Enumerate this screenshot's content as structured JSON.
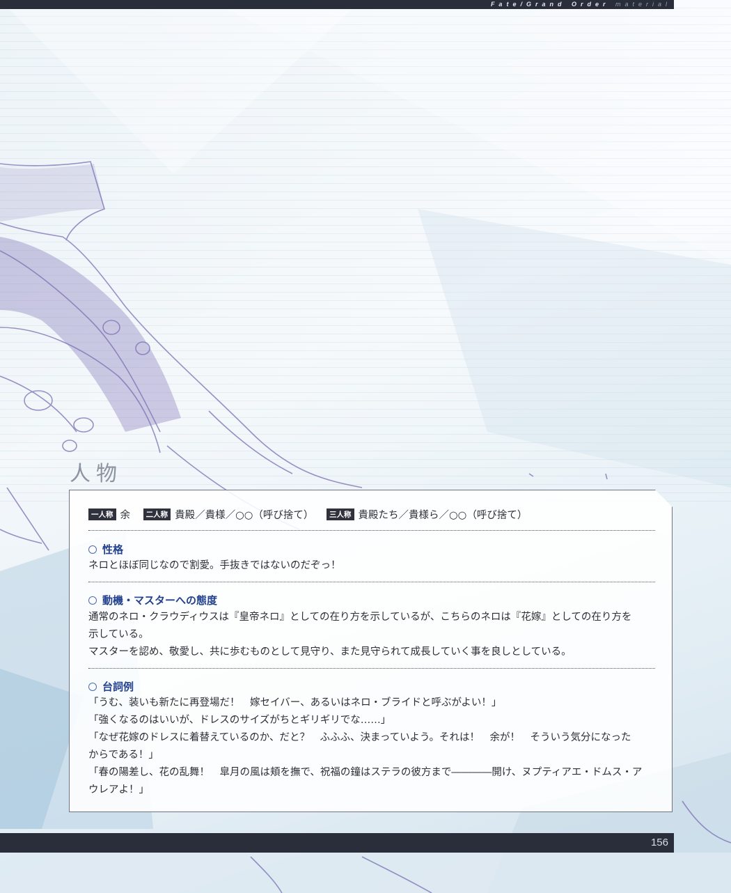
{
  "header": {
    "title_bold": "Fate/Grand Order",
    "title_light": "material"
  },
  "section": {
    "title": "人物"
  },
  "pronouns": [
    {
      "tag": "一人称",
      "value": "余"
    },
    {
      "tag": "二人称",
      "value": "貴殿／貴様／○○（呼び捨て）"
    },
    {
      "tag": "三人称",
      "value": "貴殿たち／貴様ら／○○（呼び捨て）"
    }
  ],
  "personality": {
    "heading": "性格",
    "text": "ネロとほぼ同じなので割愛。手抜きではないのだぞっ！"
  },
  "motivation": {
    "heading": "動機・マスターへの態度",
    "line1": "通常のネロ・クラウディウスは『皇帝ネロ』としての在り方を示しているが、こちらのネロは『花嫁』としての在り方を",
    "line2": "示している。",
    "line3": "マスターを認め、敬愛し、共に歩むものとして見守り、また見守られて成長していく事を良しとしている。"
  },
  "lines": {
    "heading": "台詞例",
    "l1": "「うむ、装いも新たに再登場だ！　嫁セイバー、あるいはネロ・ブライドと呼ぶがよい！」",
    "l2": "「強くなるのはいいが、ドレスのサイズがちとギリギリでな……」",
    "l3a": "「なぜ花嫁のドレスに着替えているのか、だと？　ふふふ、決まっていよう。それは！　余が！　そういう気分になった",
    "l3b": "からである！」",
    "l4a": "「春の陽差し、花の乱舞！　皐月の風は頬を撫で、祝福の鐘はステラの彼方まで――――開け、ヌプティアエ・ドムス・ア",
    "l4b": "ウレアよ！」"
  },
  "footer": {
    "page_number": "156"
  },
  "colors": {
    "bar": "#2a2d3a",
    "heading": "#23418e",
    "sketch": "#7a6fb4"
  }
}
